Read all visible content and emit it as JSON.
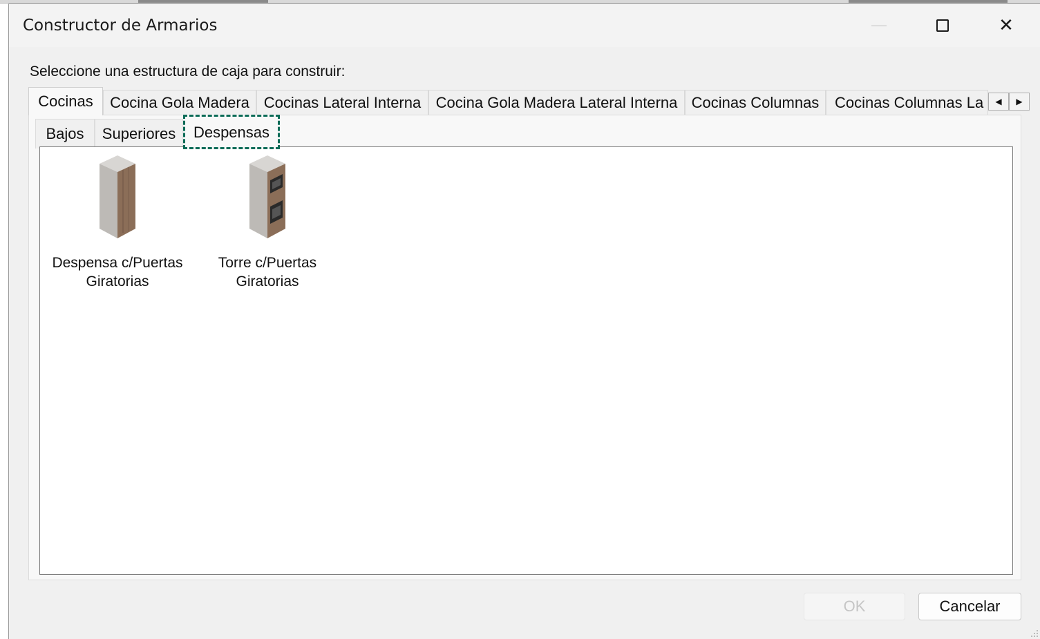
{
  "window": {
    "title": "Constructor de Armarios",
    "controls": {
      "minimize": "minimize-icon",
      "maximize": "maximize-icon",
      "close": "close-icon",
      "close_glyph": "✕"
    }
  },
  "prompt": "Seleccione una estructura de caja para construir:",
  "outer_tabs": [
    {
      "label": "Cocinas",
      "active": true
    },
    {
      "label": "Cocina Gola Madera",
      "active": false
    },
    {
      "label": "Cocinas Lateral Interna",
      "active": false
    },
    {
      "label": "Cocina Gola Madera Lateral Interna",
      "active": false
    },
    {
      "label": "Cocinas Columnas",
      "active": false
    },
    {
      "label": "Cocinas Columnas La",
      "active": false
    }
  ],
  "tab_scroll": {
    "left": "◀",
    "right": "▶"
  },
  "inner_tabs": [
    {
      "label": "Bajos",
      "active": false
    },
    {
      "label": "Superiores",
      "active": false
    },
    {
      "label": "Despensas",
      "active": true
    }
  ],
  "items": [
    {
      "line1": "Despensa c/Puertas",
      "line2": "Giratorias",
      "icon": "pantry-cabinet-icon"
    },
    {
      "line1": "Torre c/Puertas",
      "line2": "Giratorias",
      "icon": "oven-tower-icon"
    }
  ],
  "buttons": {
    "ok": "OK",
    "cancel": "Cancelar",
    "ok_enabled": false
  },
  "colors": {
    "focus_outline": "#0b6b57",
    "wood": "#8b6e58",
    "panel_grey": "#c9c6c2"
  }
}
